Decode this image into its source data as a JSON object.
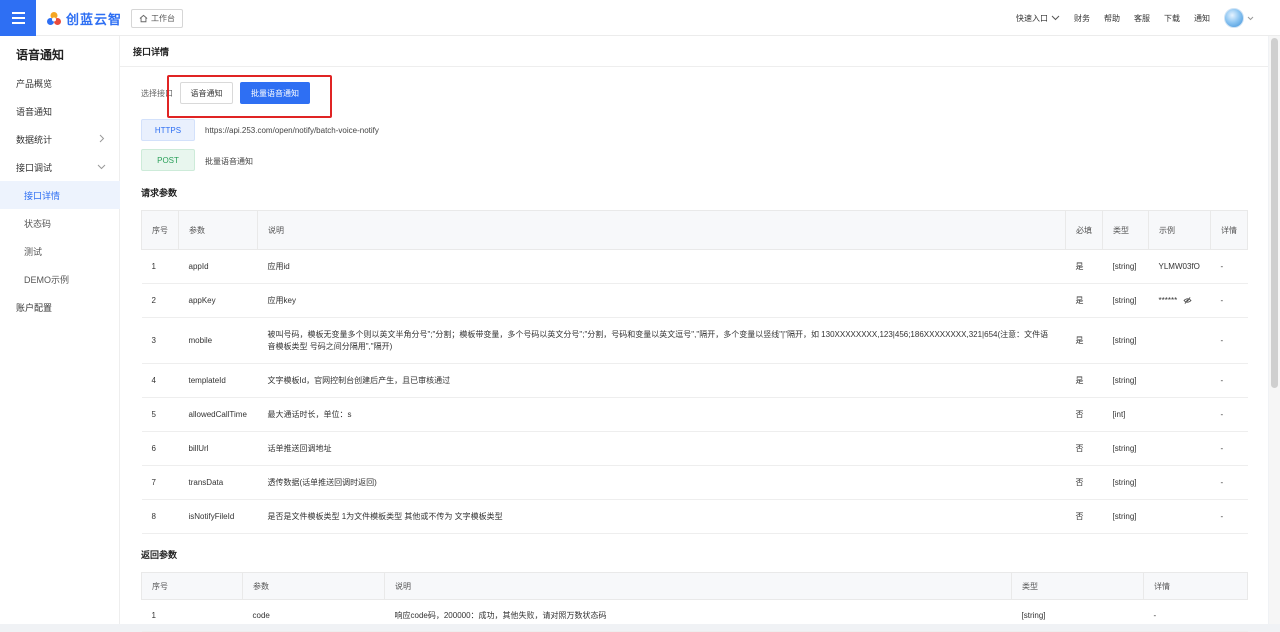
{
  "header": {
    "logo_text": "创蓝云智",
    "workspace_label": "工作台",
    "nav": {
      "quick_entry": "快速入口",
      "finance": "财务",
      "help": "帮助",
      "service": "客服",
      "download": "下载",
      "notice": "通知"
    }
  },
  "sidebar": {
    "title": "语音通知",
    "items": [
      {
        "label": "产品概览"
      },
      {
        "label": "语音通知"
      },
      {
        "label": "数据统计"
      },
      {
        "label": "接口调试"
      },
      {
        "label": "接口详情"
      },
      {
        "label": "状态码"
      },
      {
        "label": "测试"
      },
      {
        "label": "DEMO示例"
      },
      {
        "label": "账户配置"
      }
    ]
  },
  "page": {
    "title": "接口详情",
    "select_label": "选择接口",
    "btn_voice": "语音通知",
    "btn_batch": "批量语音通知",
    "https_tag": "HTTPS",
    "https_url": "https://api.253.com/open/notify/batch-voice-notify",
    "post_tag": "POST",
    "post_desc": "批量语音通知",
    "req_title": "请求参数",
    "resp_title": "返回参数"
  },
  "request_table": {
    "headers": [
      "序号",
      "参数",
      "说明",
      "必填",
      "类型",
      "示例",
      "详情"
    ],
    "rows": [
      {
        "no": "1",
        "param": "appId",
        "desc": "应用id",
        "required": "是",
        "type": "[string]",
        "example": "YLMW03fO",
        "detail": "-"
      },
      {
        "no": "2",
        "param": "appKey",
        "desc": "应用key",
        "required": "是",
        "type": "[string]",
        "example": "******",
        "detail": "-"
      },
      {
        "no": "3",
        "param": "mobile",
        "desc": "被叫号码，模板无变量多个则以英文半角分号\";\"分割；模板带变量，多个号码以英文分号\";\"分割，号码和变量以英文逗号\",\"隔开，多个变量以竖线\"|\"隔开，如 130XXXXXXXX,123|456;186XXXXXXXX,321|654(注意：文件语音模板类型 号码之间分隔用\",\"隔开)",
        "required": "是",
        "type": "[string]",
        "example": "",
        "detail": "-"
      },
      {
        "no": "4",
        "param": "templateId",
        "desc": "文字模板Id，官网控制台创建后产生，且已审核通过",
        "required": "是",
        "type": "[string]",
        "example": "",
        "detail": "-"
      },
      {
        "no": "5",
        "param": "allowedCallTime",
        "desc": "最大通话时长，单位：s",
        "required": "否",
        "type": "[int]",
        "example": "",
        "detail": "-"
      },
      {
        "no": "6",
        "param": "billUrl",
        "desc": "话单推送回调地址",
        "required": "否",
        "type": "[string]",
        "example": "",
        "detail": "-"
      },
      {
        "no": "7",
        "param": "transData",
        "desc": "透传数据(话单推送回调时返回)",
        "required": "否",
        "type": "[string]",
        "example": "",
        "detail": "-"
      },
      {
        "no": "8",
        "param": "isNotifyFileId",
        "desc": "是否是文件模板类型 1为文件模板类型 其他或不传为 文字模板类型",
        "required": "否",
        "type": "[string]",
        "example": "",
        "detail": "-"
      }
    ]
  },
  "response_table": {
    "headers": [
      "序号",
      "参数",
      "说明",
      "类型",
      "详情"
    ],
    "rows": [
      {
        "no": "1",
        "param": "code",
        "desc": "响应code码，200000：成功，其他失败，请对照万数状态码",
        "type": "[string]",
        "detail": "-"
      }
    ]
  }
}
